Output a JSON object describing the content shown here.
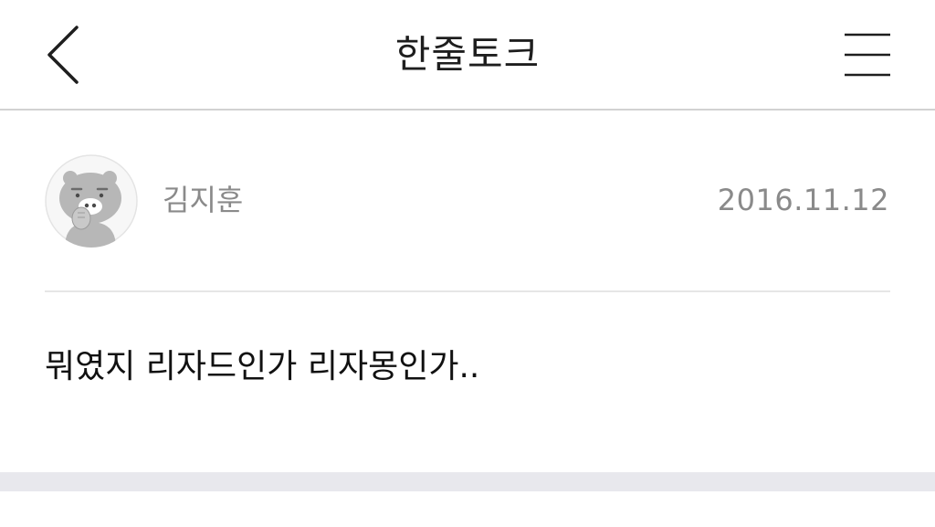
{
  "navbar": {
    "title": "한줄토크",
    "back_icon": "chevron-left-icon",
    "menu_icon": "hamburger-menu-icon"
  },
  "post": {
    "author": "김지훈",
    "date": "2016.11.12",
    "avatar_icon": "bear-avatar-icon",
    "body": "뭐였지 리자드인가 리자몽인가.."
  },
  "colors": {
    "title_text": "#1e1e1e",
    "meta_text": "#8a8a8a",
    "body_text": "#111111",
    "divider": "#e6e6e6",
    "footer_band": "#e8e8ed"
  }
}
